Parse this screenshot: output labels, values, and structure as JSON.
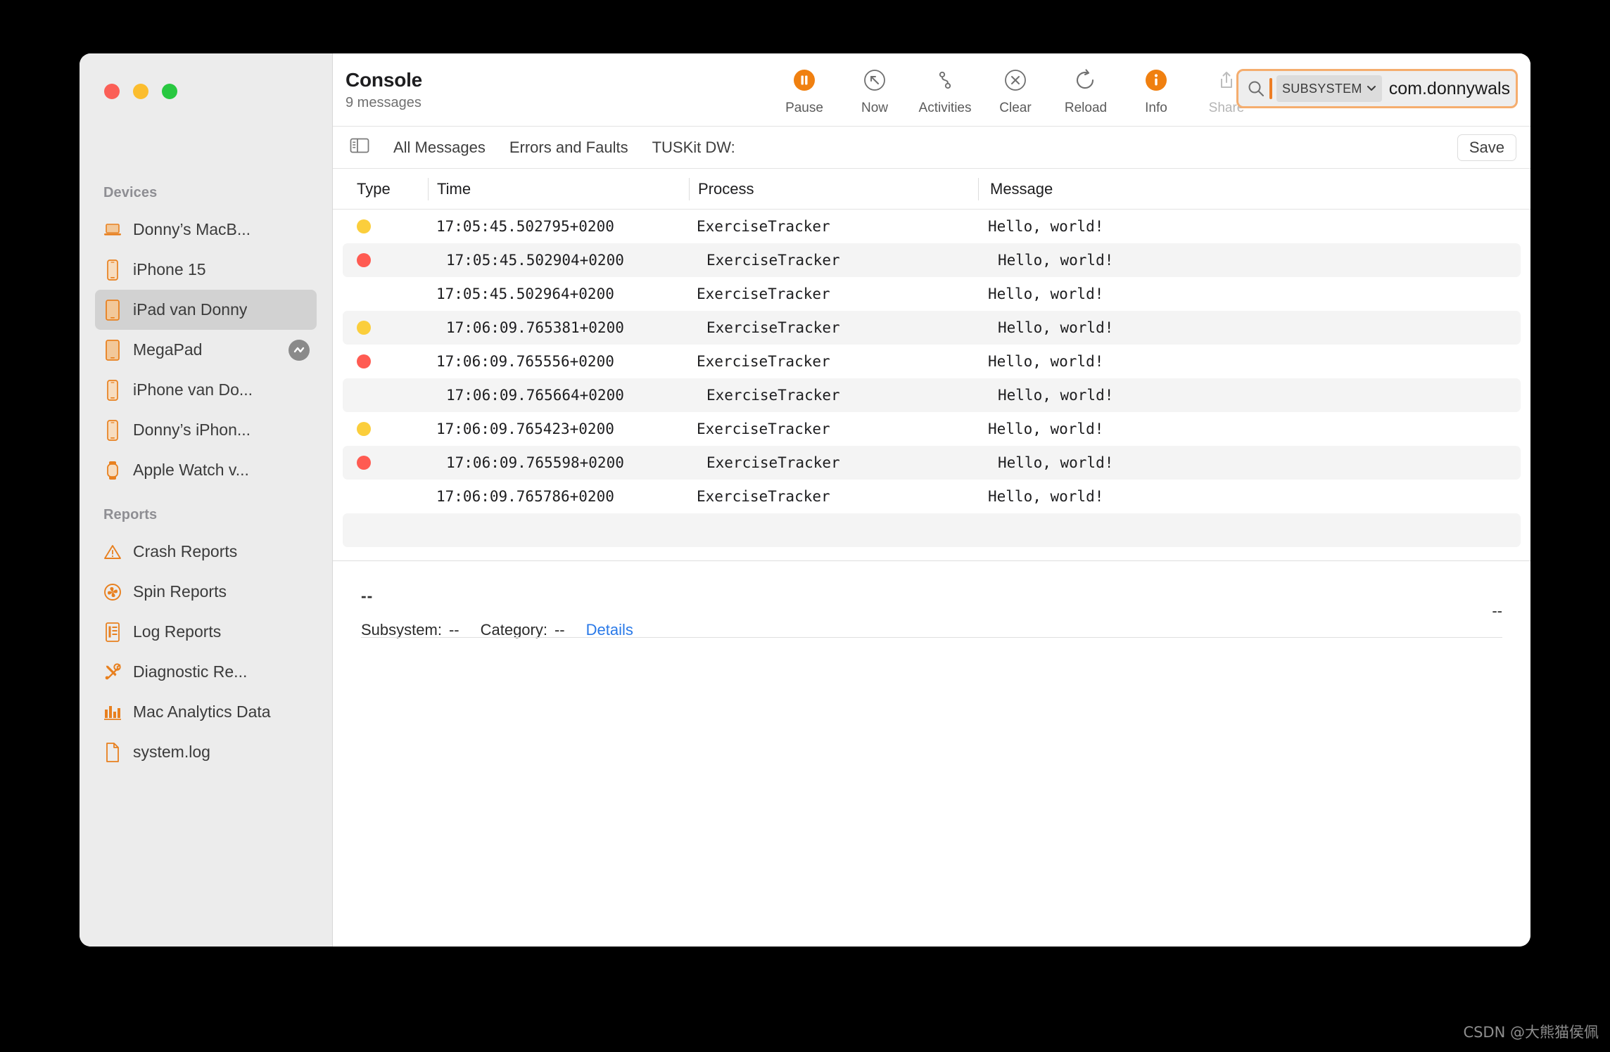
{
  "window": {
    "traffic_lights": [
      {
        "name": "close",
        "color": "#fb5f57"
      },
      {
        "name": "minimize",
        "color": "#fbbd2e"
      },
      {
        "name": "zoom",
        "color": "#28c840"
      }
    ]
  },
  "sidebar": {
    "groups": [
      {
        "title": "Devices",
        "items": [
          {
            "label": "Donny’s MacB...",
            "icon": "laptop-icon",
            "selected": false,
            "badge": null
          },
          {
            "label": "iPhone 15",
            "icon": "iphone-icon",
            "selected": false,
            "badge": null
          },
          {
            "label": "iPad van Donny",
            "icon": "ipad-icon",
            "selected": true,
            "badge": null
          },
          {
            "label": "MegaPad",
            "icon": "ipad-icon",
            "selected": false,
            "badge": "activity-badge-icon"
          },
          {
            "label": "iPhone van Do...",
            "icon": "iphone-icon",
            "selected": false,
            "badge": null
          },
          {
            "label": "Donny’s iPhon...",
            "icon": "iphone-icon",
            "selected": false,
            "badge": null
          },
          {
            "label": "Apple Watch v...",
            "icon": "watch-icon",
            "selected": false,
            "badge": null
          }
        ]
      },
      {
        "title": "Reports",
        "items": [
          {
            "label": "Crash Reports",
            "icon": "warning-triangle-icon",
            "selected": false,
            "badge": null
          },
          {
            "label": "Spin Reports",
            "icon": "spinner-icon",
            "selected": false,
            "badge": null
          },
          {
            "label": "Log Reports",
            "icon": "document-lines-icon",
            "selected": false,
            "badge": null
          },
          {
            "label": "Diagnostic Re...",
            "icon": "tools-icon",
            "selected": false,
            "badge": null
          },
          {
            "label": "Mac Analytics Data",
            "icon": "bar-chart-icon",
            "selected": false,
            "badge": null
          },
          {
            "label": "system.log",
            "icon": "file-icon",
            "selected": false,
            "badge": null
          }
        ]
      }
    ]
  },
  "toolbar": {
    "app_title": "Console",
    "message_count": "9 messages",
    "buttons": [
      {
        "label": "Pause",
        "icon": "pause-icon",
        "style": "filled-orange",
        "disabled": false
      },
      {
        "label": "Now",
        "icon": "now-arrow-icon",
        "style": "outline",
        "disabled": false
      },
      {
        "label": "Activities",
        "icon": "activities-icon",
        "style": "plain",
        "disabled": false
      },
      {
        "label": "Clear",
        "icon": "clear-x-icon",
        "style": "outline",
        "disabled": false
      },
      {
        "label": "Reload",
        "icon": "reload-icon",
        "style": "plain",
        "disabled": false
      },
      {
        "label": "Info",
        "icon": "info-icon",
        "style": "filled-orange",
        "disabled": false
      },
      {
        "label": "Share",
        "icon": "share-icon",
        "style": "plain",
        "disabled": true
      }
    ],
    "search": {
      "icon": "search-icon",
      "token_label": "SUBSYSTEM",
      "token_chevron": "chevron-down-icon",
      "value": "com.donnywals",
      "focus_color": "#f5ad6e",
      "accent_color": "#ed7d24"
    }
  },
  "filterbar": {
    "sidebar_toggle_icon": "sidebar-toggle-icon",
    "items": [
      "All Messages",
      "Errors and Faults",
      "TUSKit DW:"
    ],
    "save_label": "Save"
  },
  "table": {
    "columns": [
      "Type",
      "Time",
      "Process",
      "Message"
    ],
    "rows": [
      {
        "type": "yellow",
        "time": "17:05:45.502795+0200",
        "process": "ExerciseTracker",
        "message": "Hello, world!"
      },
      {
        "type": "red",
        "time": "17:05:45.502904+0200",
        "process": "ExerciseTracker",
        "message": "Hello, world!"
      },
      {
        "type": "none",
        "time": "17:05:45.502964+0200",
        "process": "ExerciseTracker",
        "message": "Hello, world!"
      },
      {
        "type": "yellow",
        "time": "17:06:09.765381+0200",
        "process": "ExerciseTracker",
        "message": "Hello, world!"
      },
      {
        "type": "red",
        "time": "17:06:09.765556+0200",
        "process": "ExerciseTracker",
        "message": "Hello, world!"
      },
      {
        "type": "none",
        "time": "17:06:09.765664+0200",
        "process": "ExerciseTracker",
        "message": "Hello, world!"
      },
      {
        "type": "yellow",
        "time": "17:06:09.765423+0200",
        "process": "ExerciseTracker",
        "message": "Hello, world!"
      },
      {
        "type": "red",
        "time": "17:06:09.765598+0200",
        "process": "ExerciseTracker",
        "message": "Hello, world!"
      },
      {
        "type": "none",
        "time": "17:06:09.765786+0200",
        "process": "ExerciseTracker",
        "message": "Hello, world!"
      }
    ],
    "type_colors": {
      "yellow": "#fbce3c",
      "red": "#ff5b52"
    }
  },
  "detail": {
    "title": "--",
    "subsystem_label": "Subsystem:",
    "subsystem_value": "--",
    "category_label": "Category:",
    "category_value": "--",
    "details_link": "Details",
    "right_value": "--"
  },
  "watermark": "CSDN @大熊猫侯佩"
}
